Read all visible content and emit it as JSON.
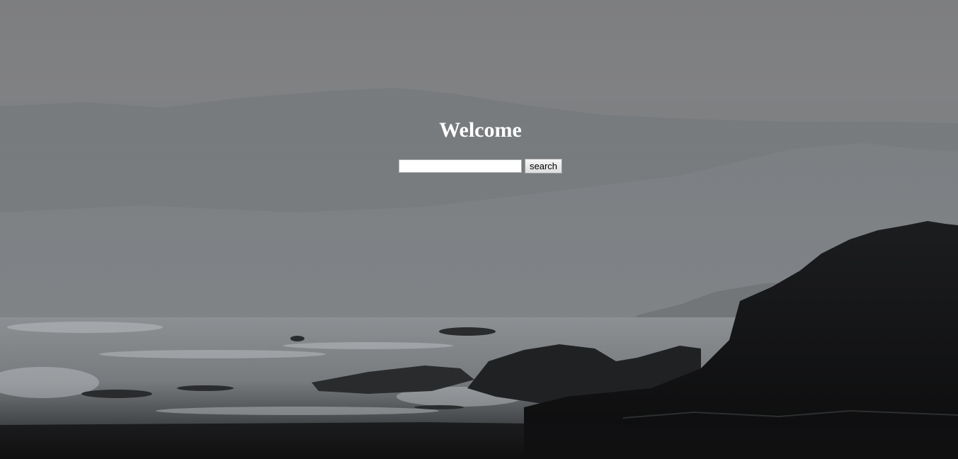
{
  "page": {
    "title": "Welcome"
  },
  "search": {
    "value": "",
    "placeholder": "",
    "button_label": "search"
  },
  "background": {
    "description_colors": {
      "sky": "#808183",
      "rocks": "#141516",
      "foam": "#b9bcbf"
    }
  }
}
